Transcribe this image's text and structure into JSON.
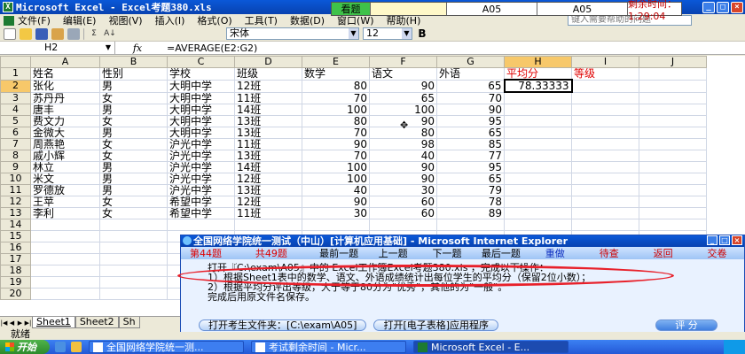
{
  "window": {
    "title": "Microsoft Excel - Excel考题380.xls",
    "minimize": "_",
    "maximize": "□",
    "close": "×"
  },
  "exam_bar": {
    "status": "看题",
    "cell_a": "A05",
    "cell_b": "A05",
    "remaining": "剩余时间：1:29:04"
  },
  "menu": {
    "items": [
      "文件(F)",
      "编辑(E)",
      "视图(V)",
      "插入(I)",
      "格式(O)",
      "工具(T)",
      "数据(D)",
      "窗口(W)",
      "帮助(H)"
    ],
    "help_placeholder": "键入需要帮助的问题"
  },
  "toolbar": {
    "font_name": "宋体",
    "font_size": "12",
    "bold": "B",
    "sigma": "Σ",
    "sort": "A↓"
  },
  "formula_bar": {
    "name_box": "H2",
    "fx": "fx",
    "formula": "=AVERAGE(E2:G2)"
  },
  "grid": {
    "columns": [
      "A",
      "B",
      "C",
      "D",
      "E",
      "F",
      "G",
      "H",
      "I",
      "J"
    ],
    "row_numbers": [
      "1",
      "2",
      "3",
      "4",
      "5",
      "6",
      "7",
      "8",
      "9",
      "10",
      "11",
      "12",
      "13",
      "14",
      "15",
      "16",
      "17",
      "18",
      "19",
      "20"
    ],
    "header_row": [
      "姓名",
      "性别",
      "学校",
      "班级",
      "数学",
      "语文",
      "外语",
      "平均分",
      "等级",
      ""
    ],
    "rows": [
      [
        "张化",
        "男",
        "大明中学",
        "12班",
        "80",
        "90",
        "65",
        "78.33333",
        "",
        ""
      ],
      [
        "苏丹丹",
        "女",
        "大明中学",
        "11班",
        "70",
        "65",
        "70",
        "",
        "",
        ""
      ],
      [
        "唐丰",
        "男",
        "大明中学",
        "14班",
        "100",
        "100",
        "90",
        "",
        "",
        ""
      ],
      [
        "费文力",
        "女",
        "大明中学",
        "13班",
        "80",
        "90",
        "95",
        "",
        "",
        ""
      ],
      [
        "金微大",
        "男",
        "大明中学",
        "13班",
        "70",
        "80",
        "65",
        "",
        "",
        ""
      ],
      [
        "周燕艳",
        "女",
        "沪光中学",
        "11班",
        "90",
        "98",
        "85",
        "",
        "",
        ""
      ],
      [
        "戚小辉",
        "女",
        "沪光中学",
        "13班",
        "70",
        "40",
        "77",
        "",
        "",
        ""
      ],
      [
        "林立",
        "男",
        "沪光中学",
        "14班",
        "100",
        "90",
        "95",
        "",
        "",
        ""
      ],
      [
        "米文",
        "男",
        "沪光中学",
        "12班",
        "100",
        "90",
        "65",
        "",
        "",
        ""
      ],
      [
        "罗德放",
        "男",
        "沪光中学",
        "13班",
        "40",
        "30",
        "79",
        "",
        "",
        ""
      ],
      [
        "王苹",
        "女",
        "希望中学",
        "12班",
        "90",
        "60",
        "78",
        "",
        "",
        ""
      ],
      [
        "李利",
        "女",
        "希望中学",
        "11班",
        "30",
        "60",
        "89",
        "",
        "",
        ""
      ]
    ]
  },
  "sheet_tabs": [
    "Sheet1",
    "Sheet2",
    "Sh"
  ],
  "status": "就绪",
  "dialog": {
    "title": "全国网络学院统一测试（中山）[计算机应用基础] - Microsoft Internet Explorer",
    "q_num": "第44题",
    "q_total": "共49题",
    "nav": [
      "最前一题",
      "上一题",
      "下一题",
      "最后一题",
      "重做",
      "待查",
      "返回",
      "交卷"
    ],
    "lines": [
      "打开『C:\\exam\\A05』中的 Excel工作簿Excel考题380.xls ，完成以下操作：",
      "1）根据Sheet1表中的数学、语文、外语成绩统计出每位学生的平均分（保留2位小数）；",
      "2）根据平均分评出等级，大于等于80分为\"优秀\"，其他的为\"一般\"。",
      "完成后用原文件名保存。"
    ],
    "btn_open_folder": "打开考生文件夹：[C:\\exam\\A05]",
    "btn_open_app": "打开[电子表格]应用程序",
    "btn_score": "评 分"
  },
  "taskbar": {
    "start": "开始",
    "tasks": [
      "全国网络学院统一测...",
      "考试剩余时间 - Micr...",
      "Microsoft Excel - E..."
    ]
  }
}
